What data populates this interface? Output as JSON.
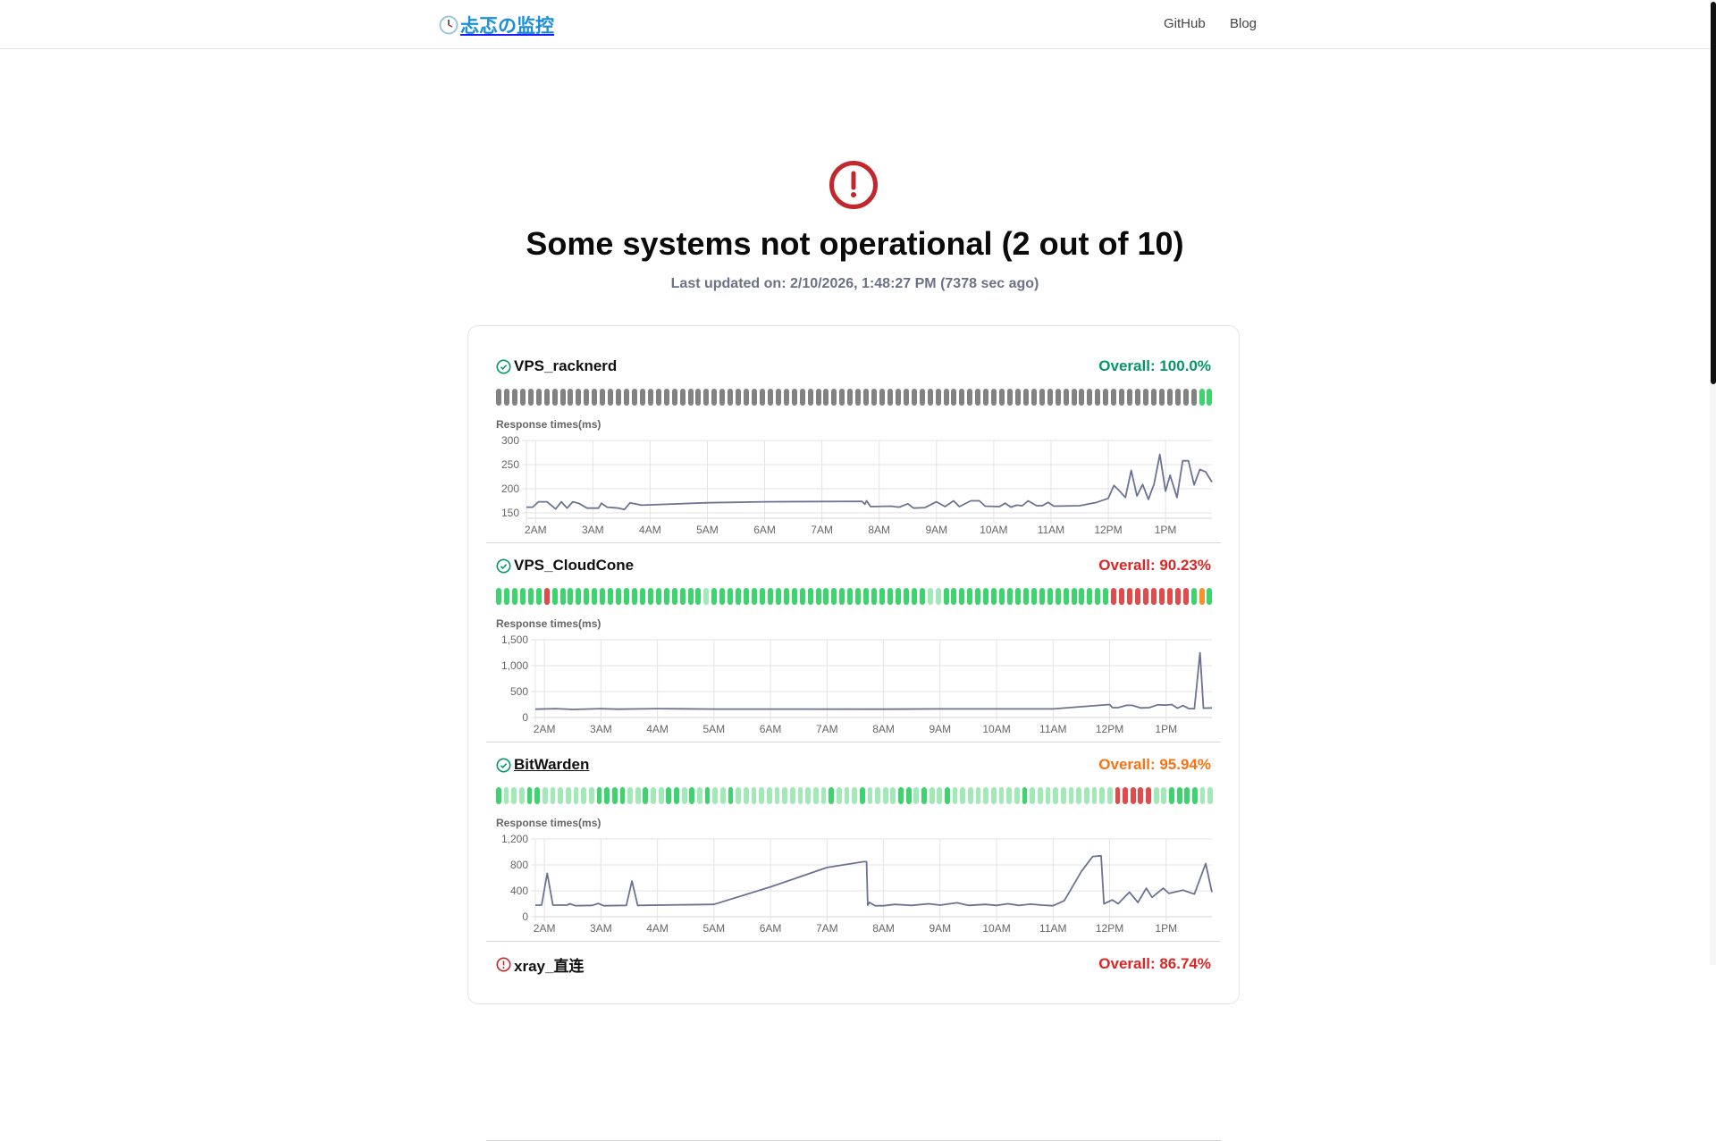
{
  "header": {
    "logo_text": "忐忑の监控",
    "nav": [
      "GitHub",
      "Blog"
    ]
  },
  "status": {
    "icon": "alert-circle-icon",
    "title": "Some systems not operational (2 out of 10)",
    "last_updated": "Last updated on: 2/10/2026, 1:48:27 PM (7378 sec ago)"
  },
  "colors": {
    "n": "#828282",
    "g": "#3dd46e",
    "l": "#a2e9b8",
    "r": "#e04b4b",
    "o": "#f3922e",
    "line": "#6b7393",
    "up": "#059669",
    "down": "#dc2626",
    "warn": "#f97316",
    "alert": "#c1272d"
  },
  "monitors": [
    {
      "name": "VPS_racknerd",
      "state": "up",
      "overall": "Overall: 100.0%",
      "overall_color": "up",
      "link": false,
      "bars": "nnnnnnnnnnnnnnnnnnnnnnnnnnnnnnnnnnnnnnnnnnnnnnnnnnnnnnnnnnnnnnnnnnnnnnnnnnnnnnnnnnnnnnnngg",
      "chart_label": "Response times(ms)"
    },
    {
      "name": "VPS_CloudCone",
      "state": "up",
      "overall": "Overall: 90.23%",
      "overall_color": "down",
      "link": false,
      "bars": "ggggggrggggggggggggggggggglgggggggggggggggggggggggggggllgggggggggggggggggggggrrrrrrrrrrgog",
      "chart_label": "Response times(ms)"
    },
    {
      "name": "BitWarden",
      "state": "up",
      "overall": "Overall: 95.94%",
      "overall_color": "warn",
      "link": true,
      "bars": "glllgglllllllggggllgllgglglgllgllllllllllllglllgllllgglgllglllllllllglllllllllllrrrrrllggggll",
      "chart_label": "Response times(ms)"
    },
    {
      "name": "xray_直连",
      "state": "down",
      "overall": "Overall: 86.74%",
      "overall_color": "down",
      "link": false,
      "bars": "",
      "chart_label": ""
    }
  ],
  "chart_data": [
    {
      "type": "line",
      "title": "Response times(ms)",
      "xlabel": "",
      "ylabel": "ms",
      "xlim": [
        1.84,
        13.81
      ],
      "ylim": [
        139,
        300
      ],
      "yticks": [
        150,
        200,
        250,
        300
      ],
      "ytick_labels": [
        "150",
        "200",
        "250",
        "300"
      ],
      "xticks": [
        2,
        3,
        4,
        5,
        6,
        7,
        8,
        9,
        10,
        11,
        12,
        13
      ],
      "xtick_labels": [
        "2AM",
        "3AM",
        "4AM",
        "5AM",
        "6AM",
        "7AM",
        "8AM",
        "9AM",
        "10AM",
        "11AM",
        "12PM",
        "1PM"
      ],
      "points": [
        [
          1.84,
          162
        ],
        [
          1.95,
          162
        ],
        [
          2.05,
          173
        ],
        [
          2.2,
          173
        ],
        [
          2.35,
          158
        ],
        [
          2.45,
          173
        ],
        [
          2.55,
          160
        ],
        [
          2.65,
          173
        ],
        [
          2.75,
          170
        ],
        [
          2.9,
          160
        ],
        [
          3.1,
          160
        ],
        [
          3.15,
          170
        ],
        [
          3.25,
          162
        ],
        [
          3.45,
          160
        ],
        [
          3.55,
          157
        ],
        [
          3.65,
          171
        ],
        [
          3.85,
          166
        ],
        [
          5,
          171
        ],
        [
          6,
          173
        ],
        [
          7.7,
          174
        ],
        [
          7.75,
          168
        ],
        [
          7.78,
          175
        ],
        [
          7.85,
          163
        ],
        [
          8.2,
          164
        ],
        [
          8.35,
          162
        ],
        [
          8.5,
          169
        ],
        [
          8.6,
          160
        ],
        [
          8.8,
          161
        ],
        [
          9,
          173
        ],
        [
          9.15,
          163
        ],
        [
          9.3,
          175
        ],
        [
          9.4,
          163
        ],
        [
          9.6,
          175
        ],
        [
          9.75,
          175
        ],
        [
          9.85,
          164
        ],
        [
          10.1,
          163
        ],
        [
          10.2,
          170
        ],
        [
          10.3,
          162
        ],
        [
          10.4,
          166
        ],
        [
          10.5,
          165
        ],
        [
          10.6,
          175
        ],
        [
          10.75,
          165
        ],
        [
          10.85,
          165
        ],
        [
          10.95,
          172
        ],
        [
          11.05,
          164
        ],
        [
          11.5,
          165
        ],
        [
          11.8,
          172
        ],
        [
          12,
          180
        ],
        [
          12.1,
          207
        ],
        [
          12.2,
          195
        ],
        [
          12.3,
          182
        ],
        [
          12.4,
          238
        ],
        [
          12.5,
          185
        ],
        [
          12.6,
          209
        ],
        [
          12.7,
          178
        ],
        [
          12.8,
          210
        ],
        [
          12.9,
          271
        ],
        [
          13.0,
          195
        ],
        [
          13.08,
          228
        ],
        [
          13.2,
          182
        ],
        [
          13.3,
          258
        ],
        [
          13.4,
          258
        ],
        [
          13.5,
          208
        ],
        [
          13.6,
          240
        ],
        [
          13.7,
          235
        ],
        [
          13.81,
          214
        ]
      ]
    },
    {
      "type": "line",
      "title": "Response times(ms)",
      "xlabel": "",
      "ylabel": "ms",
      "xlim": [
        1.84,
        13.81
      ],
      "ylim": [
        0,
        1500
      ],
      "yticks": [
        0,
        500,
        1000,
        1500
      ],
      "ytick_labels": [
        "0",
        "500",
        "1,000",
        "1,500"
      ],
      "xticks": [
        2,
        3,
        4,
        5,
        6,
        7,
        8,
        9,
        10,
        11,
        12,
        13
      ],
      "xtick_labels": [
        "2AM",
        "3AM",
        "4AM",
        "5AM",
        "6AM",
        "7AM",
        "8AM",
        "9AM",
        "10AM",
        "11AM",
        "12PM",
        "1PM"
      ],
      "points": [
        [
          1.84,
          160
        ],
        [
          2.2,
          170
        ],
        [
          2.5,
          155
        ],
        [
          3,
          170
        ],
        [
          3.3,
          160
        ],
        [
          4,
          170
        ],
        [
          5,
          162
        ],
        [
          8,
          160
        ],
        [
          9,
          165
        ],
        [
          11,
          165
        ],
        [
          12,
          250
        ],
        [
          12.05,
          190
        ],
        [
          12.15,
          190
        ],
        [
          12.3,
          235
        ],
        [
          12.4,
          235
        ],
        [
          12.55,
          185
        ],
        [
          12.7,
          190
        ],
        [
          12.85,
          245
        ],
        [
          13,
          240
        ],
        [
          13.1,
          250
        ],
        [
          13.2,
          180
        ],
        [
          13.3,
          230
        ],
        [
          13.4,
          170
        ],
        [
          13.5,
          170
        ],
        [
          13.6,
          1250
        ],
        [
          13.66,
          180
        ],
        [
          13.81,
          185
        ]
      ]
    },
    {
      "type": "line",
      "title": "Response times(ms)",
      "xlabel": "",
      "ylabel": "ms",
      "xlim": [
        1.84,
        13.81
      ],
      "ylim": [
        0,
        1200
      ],
      "yticks": [
        0,
        400,
        800,
        1200
      ],
      "ytick_labels": [
        "0",
        "400",
        "800",
        "1,200"
      ],
      "xticks": [
        2,
        3,
        4,
        5,
        6,
        7,
        8,
        9,
        10,
        11,
        12,
        13
      ],
      "xtick_labels": [
        "2AM",
        "3AM",
        "4AM",
        "5AM",
        "6AM",
        "7AM",
        "8AM",
        "9AM",
        "10AM",
        "11AM",
        "12PM",
        "1PM"
      ],
      "points": [
        [
          1.84,
          180
        ],
        [
          1.95,
          180
        ],
        [
          2.05,
          670
        ],
        [
          2.15,
          180
        ],
        [
          2.4,
          180
        ],
        [
          2.45,
          200
        ],
        [
          2.55,
          170
        ],
        [
          2.85,
          175
        ],
        [
          2.95,
          205
        ],
        [
          3.05,
          170
        ],
        [
          3.45,
          175
        ],
        [
          3.55,
          550
        ],
        [
          3.65,
          175
        ],
        [
          5,
          190
        ],
        [
          6,
          460
        ],
        [
          7,
          760
        ],
        [
          7.65,
          850
        ],
        [
          7.7,
          850
        ],
        [
          7.72,
          180
        ],
        [
          7.75,
          220
        ],
        [
          7.85,
          170
        ],
        [
          8,
          170
        ],
        [
          8.2,
          190
        ],
        [
          8.5,
          175
        ],
        [
          8.8,
          200
        ],
        [
          9,
          180
        ],
        [
          9.3,
          215
        ],
        [
          9.5,
          175
        ],
        [
          9.8,
          190
        ],
        [
          10,
          175
        ],
        [
          10.2,
          200
        ],
        [
          10.4,
          175
        ],
        [
          10.6,
          195
        ],
        [
          10.8,
          180
        ],
        [
          11,
          170
        ],
        [
          11.2,
          250
        ],
        [
          11.5,
          700
        ],
        [
          11.7,
          930
        ],
        [
          11.85,
          940
        ],
        [
          11.9,
          200
        ],
        [
          12.05,
          260
        ],
        [
          12.15,
          200
        ],
        [
          12.35,
          380
        ],
        [
          12.5,
          220
        ],
        [
          12.65,
          440
        ],
        [
          12.75,
          300
        ],
        [
          12.95,
          440
        ],
        [
          13.05,
          360
        ],
        [
          13.3,
          410
        ],
        [
          13.5,
          350
        ],
        [
          13.7,
          820
        ],
        [
          13.81,
          380
        ]
      ]
    }
  ]
}
